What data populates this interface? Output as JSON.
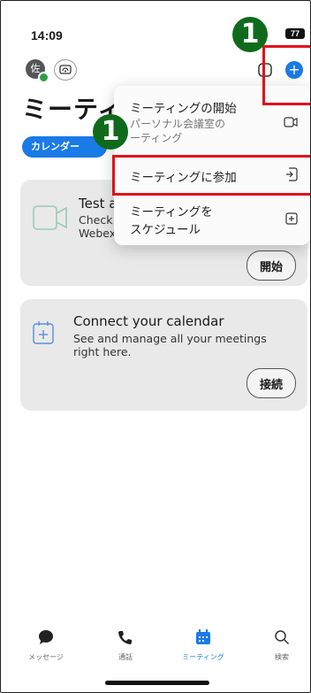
{
  "status_bar": {
    "time": "14:09",
    "battery": "77"
  },
  "header": {
    "avatar_initial": "佐",
    "title": "ミーティ"
  },
  "filter": {
    "calendar_label": "カレンダー"
  },
  "dropdown": {
    "items": [
      {
        "label": "ミーティングの開始",
        "sub_line1": "パーソナル会議室の",
        "sub_line2": "ーティング"
      },
      {
        "label": "ミーティングに参加"
      },
      {
        "label_line1": "ミーティングを",
        "label_line2": "スケジュール"
      }
    ]
  },
  "cards": {
    "test": {
      "title": "Test a",
      "sub_line1": "Check",
      "sub_line2": "Webex",
      "button": "開始"
    },
    "calendar": {
      "title": "Connect your calendar",
      "sub_line1": "See and manage all your meetings",
      "sub_line2": "right here.",
      "button": "接続"
    }
  },
  "annotations": {
    "badge1": "1",
    "badge2": "1",
    "highlight_color": "#e0101c",
    "badge_color": "#0f6b1b"
  },
  "tabbar": {
    "items": [
      {
        "label": "メッセージ",
        "icon": "chat-bubble-icon"
      },
      {
        "label": "通話",
        "icon": "phone-icon"
      },
      {
        "label": "ミーティング",
        "icon": "calendar-icon",
        "active": true
      },
      {
        "label": "検索",
        "icon": "search-icon"
      }
    ]
  },
  "colors": {
    "accent": "#1a7ae6"
  }
}
